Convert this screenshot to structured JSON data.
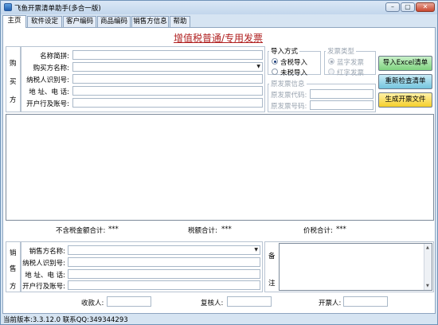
{
  "window": {
    "title": "飞鱼开票清单助手(多合一版)"
  },
  "tabs": [
    "主页",
    "软件设定",
    "客户编码",
    "商品编码",
    "销售方信息",
    "帮助"
  ],
  "invoice_title": "增值税普通/专用发票",
  "buyer": {
    "side_chars": [
      "购",
      "买",
      "方"
    ],
    "name_search_label": "名称简拼:",
    "name_label": "购买方名称:",
    "tax_id_label": "纳税人识别号:",
    "address_label": "地 址、电 话:",
    "bank_label": "开户行及账号:"
  },
  "import_mode": {
    "title": "导入方式",
    "options": [
      "含税导入",
      "未税导入"
    ],
    "selected": 0
  },
  "invoice_type": {
    "title": "发票类型",
    "options": [
      "蓝字发票",
      "红字发票"
    ],
    "selected": 0
  },
  "original_invoice": {
    "title": "原发票信息",
    "code_label": "原发票代码:",
    "number_label": "原发票号码:"
  },
  "buttons": {
    "import_excel": "导入Excel清单",
    "recheck": "重新检查清单",
    "generate": "生成开票文件"
  },
  "colors": {
    "import_btn": "#7fd37f",
    "recheck_btn": "#74c4de",
    "generate_btn": "#f5cf2a",
    "heading": "#b02020"
  },
  "totals": {
    "amount_label": "不含税金额合计:",
    "amount_value": "***",
    "tax_label": "税额合计:",
    "tax_value": "***",
    "total_label": "价税合计:",
    "total_value": "***"
  },
  "seller": {
    "side_chars": [
      "销",
      "售",
      "方"
    ],
    "name_label": "销售方名称:",
    "tax_id_label": "纳税人识别号:",
    "address_label": "地 址、电 话:",
    "bank_label": "开户行及账号:"
  },
  "remarks": {
    "chars": [
      "备",
      "注"
    ]
  },
  "signers": {
    "payee_label": "收款人:",
    "reviewer_label": "复核人:",
    "drawer_label": "开票人:"
  },
  "status": {
    "version_label": "当前版本:",
    "version": "3.3.12.0",
    "contact_label": "联系QQ:",
    "qq": "349344293"
  }
}
